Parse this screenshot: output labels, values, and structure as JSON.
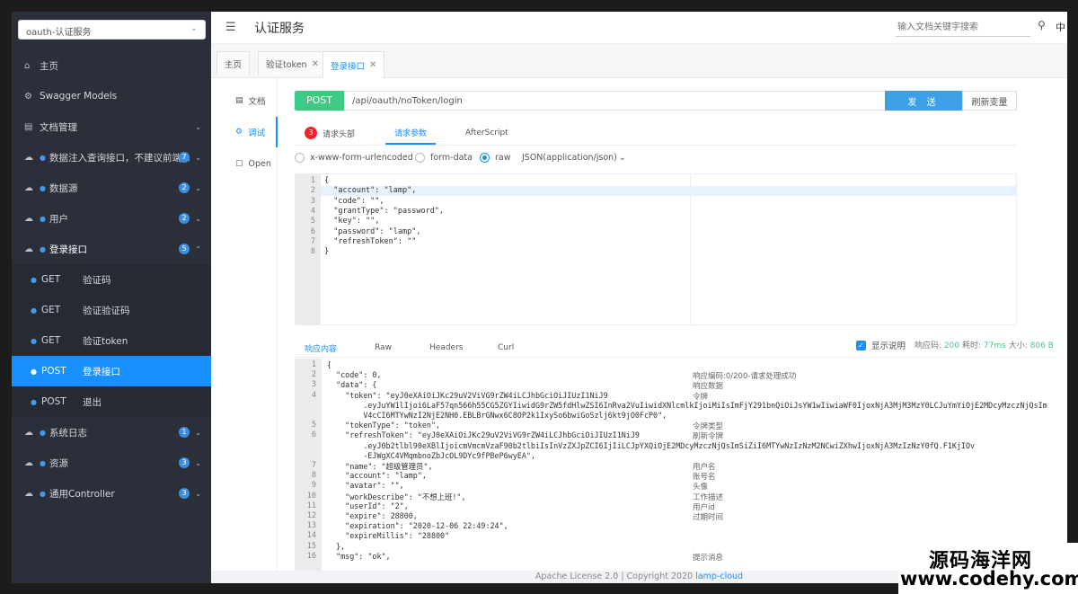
{
  "sidebar": {
    "service_select": "oauth-认证服务",
    "items": [
      {
        "label": "主页",
        "icon": "home-icon",
        "glyph": "⌂",
        "badge": "",
        "chevron": ""
      },
      {
        "label": "Swagger Models",
        "icon": "gear-icon",
        "glyph": "⚙",
        "badge": "",
        "chevron": ""
      },
      {
        "label": "文档管理",
        "icon": "doc-icon",
        "glyph": "▤",
        "badge": "",
        "chevron": "⌄"
      },
      {
        "label": "数据注入查询接口，不建议前端...",
        "icon": "cloud-icon",
        "glyph": "☁",
        "badge": "7",
        "chevron": "⌄"
      },
      {
        "label": "数据源",
        "icon": "cloud-icon",
        "glyph": "☁",
        "badge": "2",
        "chevron": "⌄"
      },
      {
        "label": "用户",
        "icon": "cloud-icon",
        "glyph": "☁",
        "badge": "2",
        "chevron": "⌄"
      },
      {
        "label": "登录接口",
        "icon": "cloud-icon",
        "glyph": "☁",
        "badge": "5",
        "chevron": "⌃"
      }
    ],
    "sub_items": [
      {
        "method": "GET",
        "label": "验证码"
      },
      {
        "method": "GET",
        "label": "验证验证码"
      },
      {
        "method": "GET",
        "label": "验证token"
      },
      {
        "method": "POST",
        "label": "登录接口"
      },
      {
        "method": "POST",
        "label": "退出"
      }
    ],
    "bottom_items": [
      {
        "label": "系统日志",
        "badge": "1",
        "chevron": "⌄"
      },
      {
        "label": "资源",
        "badge": "3",
        "chevron": "⌄"
      },
      {
        "label": "通用Controller",
        "badge": "3",
        "chevron": "⌄"
      }
    ]
  },
  "header": {
    "title": "认证服务",
    "search_placeholder": "输入文档关键字搜索",
    "lang": "中"
  },
  "tabs": [
    {
      "label": "主页",
      "closable": false
    },
    {
      "label": "验证token",
      "closable": true
    },
    {
      "label": "登录接口",
      "closable": true
    }
  ],
  "doc_nav": [
    {
      "label": "文档",
      "icon": "doc-icon"
    },
    {
      "label": "调试",
      "icon": "debug-icon"
    },
    {
      "label": "Open",
      "icon": "file-icon"
    }
  ],
  "request": {
    "method": "POST",
    "url": "/api/oauth/noToken/login",
    "send_label": "发 送",
    "refresh_label": "刷新变量",
    "tabs": [
      "请求头部",
      "请求参数",
      "AfterScript"
    ],
    "header_count": "3",
    "body_types": [
      "x-www-form-urlencoded",
      "form-data",
      "raw"
    ],
    "content_type": "JSON(application/json)",
    "body_lines": [
      "{",
      "  \"account\": \"lamp\",",
      "  \"code\": \"\",",
      "  \"grantType\": \"password\",",
      "  \"key\": \"\",",
      "  \"password\": \"lamp\",",
      "  \"refreshToken\": \"\"",
      "}"
    ]
  },
  "response": {
    "tabs": [
      "响应内容",
      "Raw",
      "Headers",
      "Curl"
    ],
    "show_desc_label": "显示说明",
    "status_label": "响应码:",
    "status_value": "200",
    "time_label": "耗时:",
    "time_value": "77ms",
    "size_label": "大小:",
    "size_value": "806 B",
    "lines": [
      {
        "n": "1",
        "t": "{",
        "d": ""
      },
      {
        "n": "2",
        "t": "  \"code\": 0,",
        "d": "响应编码:0/200-请求处理成功"
      },
      {
        "n": "3",
        "t": "  \"data\": {",
        "d": "响应数据"
      },
      {
        "n": "4",
        "t": "    \"token\": \"eyJ0eXAiOiJKc29uV2ViVG9rZW4iLCJhbGciOiJIUzI1NiJ9",
        "d": "令牌"
      },
      {
        "n": "",
        "t": "        .eyJuYW1lIjoi6LaF57qn566h55CG5ZGYIiwidG9rZW5fdHlwZSI6InRva2VuIiwidXNlcmlkIjoiMiIsImFjY291bnQiOiJsYW1wIiwiaWF0IjoxNjA3MjM3MzY0LCJuYmYiOjE2MDcyMzczNjQsIm",
        "d": ""
      },
      {
        "n": "",
        "t": "        V4cCI6MTYwNzI2NjE2NH0.EBLBrGNwx6C8OP2k1IxySo6bwiGoSzlj6kt9jO0FcP0\",",
        "d": ""
      },
      {
        "n": "5",
        "t": "    \"tokenType\": \"token\",",
        "d": "令牌类型"
      },
      {
        "n": "6",
        "t": "    \"refreshToken\": \"eyJ0eXAiOiJKc29uV2ViVG9rZW4iLCJhbGciOiJIUzI1NiJ9",
        "d": "刷新令牌"
      },
      {
        "n": "",
        "t": "        .eyJ0b2tlbl90eXBlIjoicmVmcmVzaF90b2tlbiIsInVzZXJpZCI6IjIiLCJpYXQiOjE2MDcyMzczNjQsImSiZiI6MTYwNzIzNzM2NCwiZXhwIjoxNjA3MzIzNzY0fQ.F1KjIOv",
        "d": ""
      },
      {
        "n": "",
        "t": "        -EJWgXC4VMqmbnoZbJcOL9DYc9fPBeP6wyEA\",",
        "d": ""
      },
      {
        "n": "7",
        "t": "    \"name\": \"超级管理员\",",
        "d": "用户名"
      },
      {
        "n": "8",
        "t": "    \"account\": \"lamp\",",
        "d": "账号名"
      },
      {
        "n": "9",
        "t": "    \"avatar\": \"\",",
        "d": "头像"
      },
      {
        "n": "10",
        "t": "    \"workDescribe\": \"不想上班!\",",
        "d": "工作描述"
      },
      {
        "n": "11",
        "t": "    \"userId\": \"2\",",
        "d": "用户id"
      },
      {
        "n": "12",
        "t": "    \"expire\": 28800,",
        "d": "过期时间"
      },
      {
        "n": "13",
        "t": "    \"expiration\": \"2020-12-06 22:49:24\",",
        "d": ""
      },
      {
        "n": "14",
        "t": "    \"expireMillis\": \"28800\"",
        "d": ""
      },
      {
        "n": "15",
        "t": "  },",
        "d": ""
      },
      {
        "n": "16",
        "t": "  \"msg\": \"ok\",",
        "d": "提示消息"
      }
    ]
  },
  "footer": {
    "text": "Apache License 2.0 | Copyright 2020",
    "link": "lamp-cloud"
  },
  "watermark": {
    "line1": "源码海洋网",
    "line2": "www.codehy.com"
  }
}
